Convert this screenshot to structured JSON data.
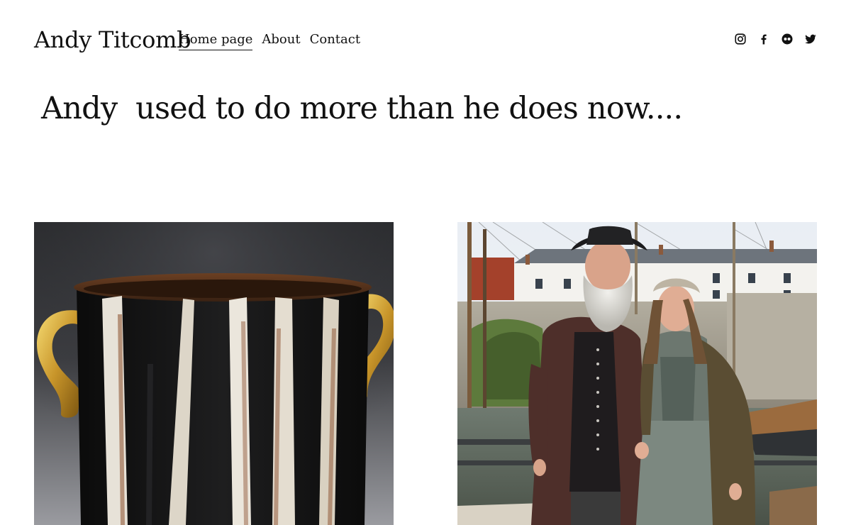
{
  "header": {
    "site_title": "Andy Titcomb",
    "nav": [
      {
        "label": "Home page",
        "active": true
      },
      {
        "label": "About",
        "active": false
      },
      {
        "label": "Contact",
        "active": false
      }
    ],
    "social": [
      "instagram-icon",
      "facebook-icon",
      "flickr-icon",
      "twitter-icon"
    ]
  },
  "hero": {
    "headline": "Andy  used to do more than he does now...."
  },
  "gallery": {
    "items": [
      {
        "name": "pottery-image",
        "subject": "black and white striped pot with gold handles"
      },
      {
        "name": "harbour-photo",
        "subject": "man and woman in period costume at harbour"
      }
    ]
  },
  "colors": {
    "text": "#111111",
    "background": "#ffffff"
  }
}
